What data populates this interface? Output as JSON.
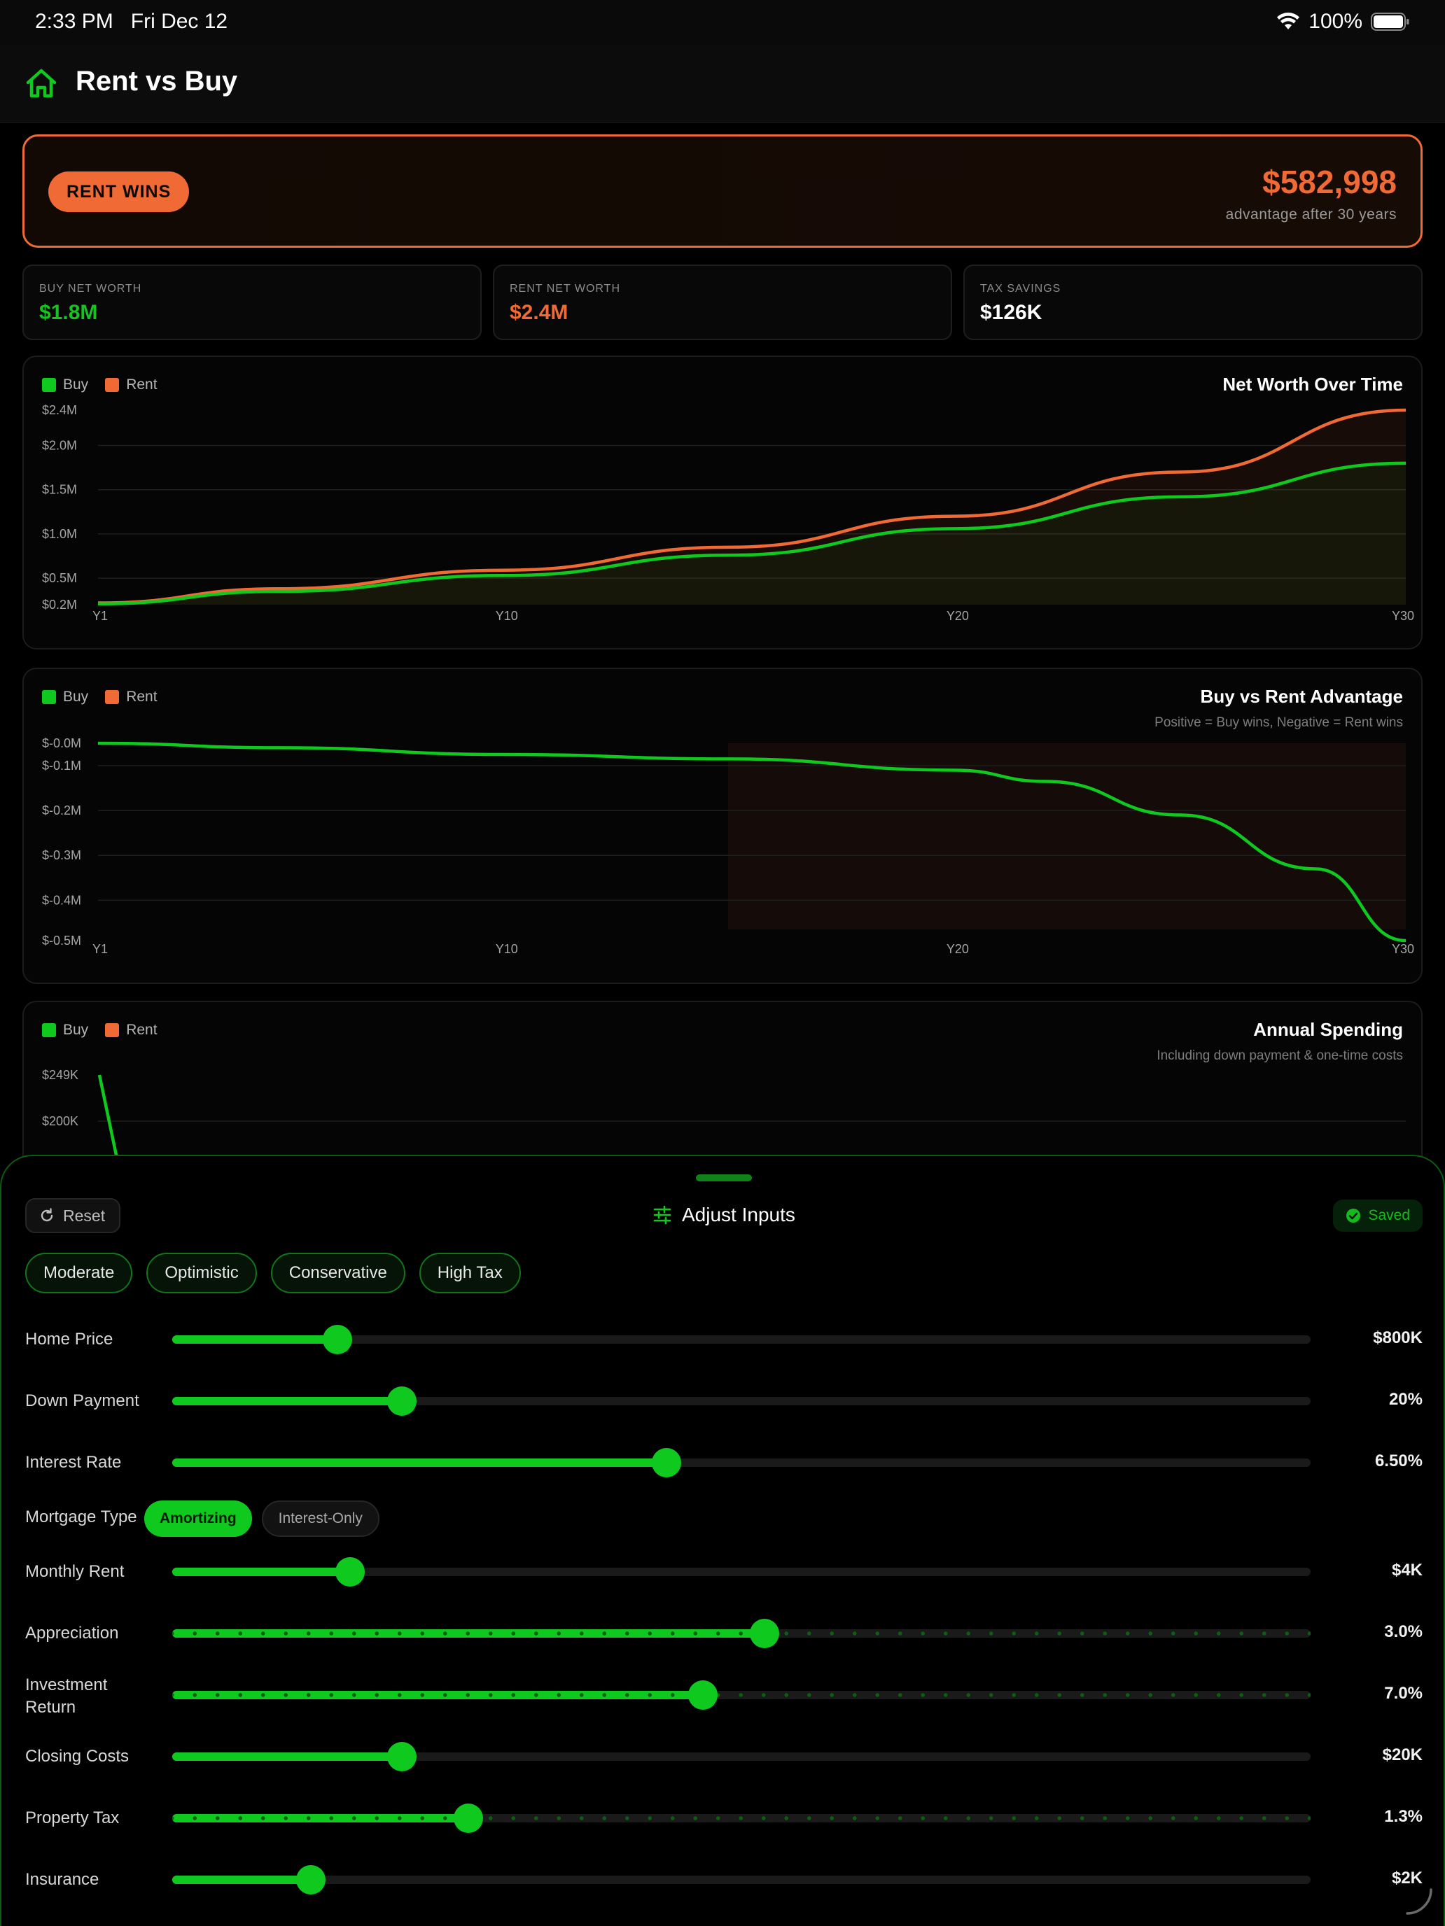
{
  "status_bar": {
    "time": "2:33 PM",
    "date": "Fri Dec 12",
    "battery": "100%"
  },
  "nav": {
    "title": "Rent vs Buy",
    "home_icon": "house-icon"
  },
  "verdict": {
    "badge": "RENT WINS",
    "amount": "$582,998",
    "subtitle": "advantage after 30 years"
  },
  "stats": [
    {
      "label": "BUY NET WORTH",
      "value": "$1.8M",
      "color": "#19c223"
    },
    {
      "label": "RENT NET WORTH",
      "value": "$2.4M",
      "color": "#f06a35"
    },
    {
      "label": "TAX SAVINGS",
      "value": "$126K",
      "color": "#ffffff"
    }
  ],
  "legend": {
    "buy": "Buy",
    "rent": "Rent",
    "buy_color": "#10c91e",
    "rent_color": "#f06a35"
  },
  "chart_data": [
    {
      "type": "line",
      "title": "Net Worth Over Time",
      "x_tick_labels": [
        "Y1",
        "Y10",
        "Y20",
        "Y30"
      ],
      "y_tick_labels": [
        "$2.4M",
        "$2.0M",
        "$1.5M",
        "$1.0M",
        "$0.5M",
        "$0.2M"
      ],
      "x": [
        1,
        5,
        10,
        15,
        20,
        25,
        30
      ],
      "ylim": [
        0.2,
        2.4
      ],
      "series": [
        {
          "name": "Buy",
          "color": "#10c91e",
          "values": [
            0.21,
            0.35,
            0.53,
            0.76,
            1.06,
            1.42,
            1.8
          ]
        },
        {
          "name": "Rent",
          "color": "#f06a35",
          "values": [
            0.22,
            0.38,
            0.59,
            0.85,
            1.2,
            1.7,
            2.4
          ]
        }
      ],
      "grid": true
    },
    {
      "type": "line",
      "title": "Buy vs Rent Advantage",
      "subtitle": "Positive = Buy wins, Negative = Rent wins",
      "x_tick_labels": [
        "Y1",
        "Y10",
        "Y20",
        "Y30"
      ],
      "y_tick_labels": [
        "$-0.0M",
        "$-0.1M",
        "$-0.2M",
        "$-0.3M",
        "$-0.4M",
        "$-0.5M"
      ],
      "x": [
        1,
        5,
        10,
        15,
        20,
        22,
        25,
        28,
        30
      ],
      "ylim": [
        -0.44,
        0.0
      ],
      "series": [
        {
          "name": "Advantage",
          "color": "#10c91e",
          "values": [
            0.0,
            -0.01,
            -0.025,
            -0.035,
            -0.06,
            -0.085,
            -0.16,
            -0.28,
            -0.44
          ]
        }
      ],
      "grid": true
    },
    {
      "type": "line",
      "title": "Annual Spending",
      "subtitle": "Including down payment & one-time costs",
      "y_tick_labels": [
        "$249K",
        "$200K"
      ],
      "x": [
        1,
        1.2
      ],
      "series": [
        {
          "name": "Buy",
          "color": "#10c91e",
          "values": [
            249,
            190
          ]
        }
      ],
      "grid": true
    }
  ],
  "sheet": {
    "reset_label": "Reset",
    "title": "Adjust Inputs",
    "saved_label": "Saved",
    "presets": [
      "Moderate",
      "Optimistic",
      "Conservative",
      "High Tax"
    ],
    "sliders": [
      {
        "key": "home_price",
        "label": "Home Price",
        "value": "$800K",
        "fraction": 0.145,
        "dotted": false
      },
      {
        "key": "down_payment",
        "label": "Down Payment",
        "value": "20%",
        "fraction": 0.202,
        "dotted": false
      },
      {
        "key": "interest_rate",
        "label": "Interest Rate",
        "value": "6.50%",
        "fraction": 0.434,
        "dotted": false
      },
      {
        "key": "monthly_rent",
        "label": "Monthly Rent",
        "value": "$4K",
        "fraction": 0.156,
        "dotted": false
      },
      {
        "key": "appreciation",
        "label": "Appreciation",
        "value": "3.0%",
        "fraction": 0.52,
        "dotted": true
      },
      {
        "key": "investment_return",
        "label": "Investment Return",
        "value": "7.0%",
        "fraction": 0.466,
        "dotted": true
      },
      {
        "key": "closing_costs",
        "label": "Closing Costs",
        "value": "$20K",
        "fraction": 0.202,
        "dotted": false
      },
      {
        "key": "property_tax",
        "label": "Property Tax",
        "value": "1.3%",
        "fraction": 0.26,
        "dotted": true
      },
      {
        "key": "insurance",
        "label": "Insurance",
        "value": "$2K",
        "fraction": 0.122,
        "dotted": false
      }
    ],
    "mortgage_type": {
      "label": "Mortgage Type",
      "options": [
        "Amortizing",
        "Interest-Only"
      ],
      "selected": "Amortizing"
    }
  }
}
